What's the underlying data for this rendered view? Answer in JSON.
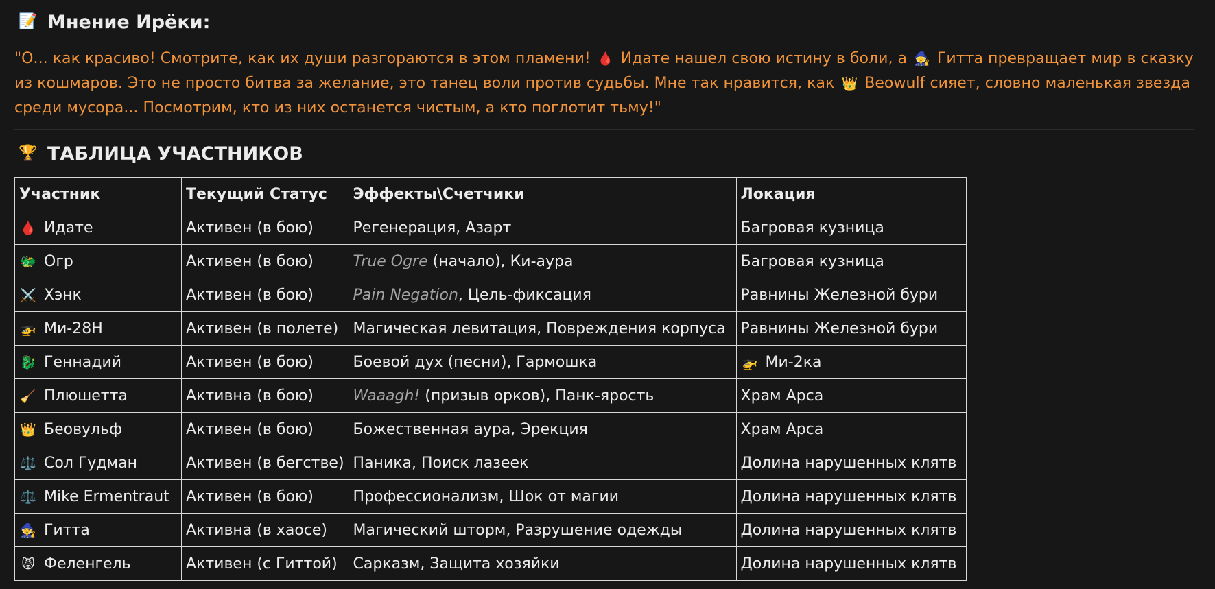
{
  "opinion": {
    "icon": "📝",
    "title": "Мнение Ирёки:",
    "quote_parts": {
      "p1": "\"О... как красиво! Смотрите, как их души разгораются в этом пламени!",
      "icon_drop": "🩸",
      "p2": "Идате нашел свою истину в боли, а",
      "icon_mage": "🧙",
      "p3": "Гитта превращает мир в сказку из кошмаров. Это не просто битва за желание, это танец воли против судьбы. Мне так нравится, как",
      "icon_crown": "👑",
      "p4": "Beowulf сияет, словно маленькая звезда среди мусора... Посмотрим, кто из них останется чистым, а кто поглотит тьму!\""
    }
  },
  "table": {
    "icon": "🏆",
    "title": "ТАБЛИЦА УЧАСТНИКОВ",
    "headers": [
      "Участник",
      "Текущий Статус",
      "Эффекты\\Счетчики",
      "Локация"
    ],
    "rows": [
      {
        "icon": "🩸",
        "name": "Идате",
        "status": "Активен (в бою)",
        "effects_italic": "",
        "effects": "Регенерация, Азарт",
        "loc_icon": "",
        "location": "Багровая кузница"
      },
      {
        "icon": "🐲",
        "name": "Огр",
        "status": "Активен (в бою)",
        "effects_italic": "True Ogre",
        "effects": " (начало), Ки-аура",
        "loc_icon": "",
        "location": "Багровая кузница"
      },
      {
        "icon": "⚔️",
        "name": "Хэнк",
        "status": "Активен (в бою)",
        "effects_italic": "Pain Negation",
        "effects": ", Цель-фиксация",
        "loc_icon": "",
        "location": "Равнины Железной бури"
      },
      {
        "icon": "🚁",
        "name": "Ми-28Н",
        "status": "Активен (в полете)",
        "effects_italic": "",
        "effects": "Магическая левитация, Повреждения корпуса",
        "loc_icon": "",
        "location": "Равнины Железной бури"
      },
      {
        "icon": "🐉",
        "name": "Геннадий",
        "status": "Активен (в бою)",
        "effects_italic": "",
        "effects": "Боевой дух (песни), Гармошка",
        "loc_icon": "🚁",
        "location": "Ми-2ка"
      },
      {
        "icon": "🧹",
        "name": "Плюшетта",
        "status": "Активна (в бою)",
        "effects_italic": "Waaagh!",
        "effects": " (призыв орков), Панк-ярость",
        "loc_icon": "",
        "location": "Храм Арса"
      },
      {
        "icon": "👑",
        "name": "Беовульф",
        "status": "Активен (в бою)",
        "effects_italic": "",
        "effects": "Божественная аура, Эрекция",
        "loc_icon": "",
        "location": "Храм Арса"
      },
      {
        "icon": "⚖️",
        "name": "Сол Гудман",
        "status": "Активен (в бегстве)",
        "effects_italic": "",
        "effects": "Паника, Поиск лазеек",
        "loc_icon": "",
        "location": "Долина нарушенных клятв"
      },
      {
        "icon": "⚖️",
        "name": "Mike Ermentraut",
        "status": "Активен (в бою)",
        "effects_italic": "",
        "effects": "Профессионализм, Шок от магии",
        "loc_icon": "",
        "location": "Долина нарушенных клятв"
      },
      {
        "icon": "🧙",
        "name": "Гитта",
        "status": "Активна (в хаосе)",
        "effects_italic": "",
        "effects": "Магический шторм, Разрушение одежды",
        "loc_icon": "",
        "location": "Долина нарушенных клятв"
      },
      {
        "icon": "😾",
        "name": "Феленгель",
        "status": "Активен (с Гиттой)",
        "effects_italic": "",
        "effects": "Сарказм, Защита хозяйки",
        "loc_icon": "",
        "location": "Долина нарушенных клятв"
      }
    ]
  },
  "colors": {
    "background": "#171717",
    "quote_text": "#f0933a",
    "italic_text": "#a3a3a3",
    "border": "#d8d8d8"
  }
}
